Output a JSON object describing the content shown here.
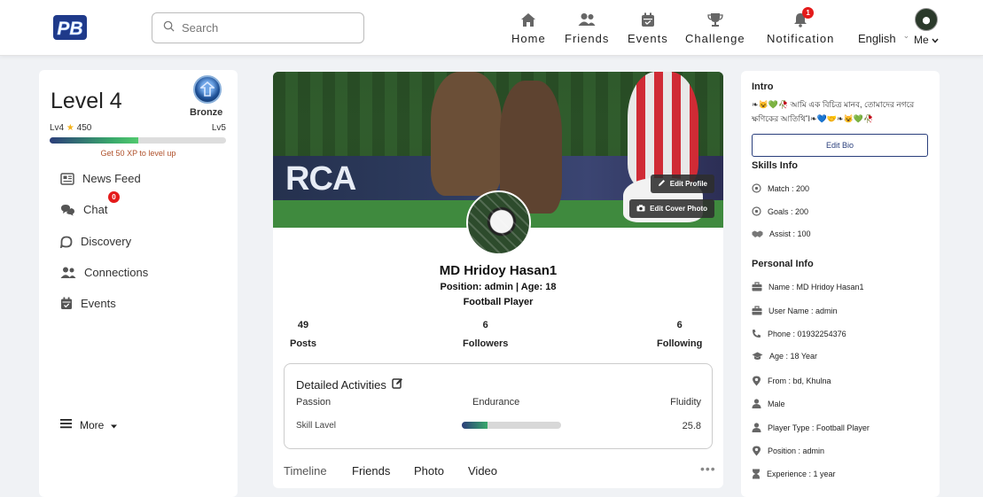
{
  "header": {
    "logo_text": "PB",
    "search_placeholder": "Search",
    "nav": [
      {
        "label": "Home",
        "icon": "home-icon"
      },
      {
        "label": "Friends",
        "icon": "friends-icon"
      },
      {
        "label": "Events",
        "icon": "calendar-icon"
      },
      {
        "label": "Challenge",
        "icon": "trophy-icon"
      },
      {
        "label": "Notification",
        "icon": "bell-icon",
        "badge": "1"
      }
    ],
    "language": "English",
    "me_label": "Me"
  },
  "left": {
    "level_title": "Level 4",
    "rank": "Bronze",
    "current_level": "Lv4",
    "xp": "450",
    "next_level": "Lv5",
    "xp_progress": 0.5,
    "xp_note": "Get 50 XP to level up",
    "menu": [
      {
        "label": "News Feed",
        "icon": "newspaper-icon"
      },
      {
        "label": "Chat",
        "icon": "chat-icon",
        "badge": "0"
      },
      {
        "label": "Discovery",
        "icon": "discovery-icon"
      },
      {
        "label": "Connections",
        "icon": "connections-icon"
      },
      {
        "label": "Events",
        "icon": "calendar-check-icon"
      }
    ],
    "more_label": "More"
  },
  "profile": {
    "cover_text": "RCA",
    "edit_profile_label": "Edit Profile",
    "edit_cover_label": "Edit Cover Photo",
    "name": "MD Hridoy Hasan1",
    "position_line": "Position: admin | Age: 18",
    "role_line": "Football Player",
    "stats": [
      {
        "value": "49",
        "label": "Posts"
      },
      {
        "value": "6",
        "label": "Followers"
      },
      {
        "value": "6",
        "label": "Following"
      }
    ],
    "activities": {
      "title": "Detailed Activities",
      "headers": [
        "Passion",
        "Endurance",
        "Fluidity"
      ],
      "skill_label": "Skill Lavel",
      "skill_value": "25.8",
      "skill_fraction": 0.26
    },
    "tabs": [
      "Timeline",
      "Friends",
      "Photo",
      "Video"
    ],
    "more_dots": "•••"
  },
  "right": {
    "intro_heading": "Intro",
    "bio": "❧😺💚🥀 আমি এক বিচিত্র মানব, তোমাদের নগরে ক্ষণিকের আতিথিἼ❧💙🤝❧😺💚🥀",
    "edit_bio_label": "Edit Bio",
    "skills_heading": "Skills Info",
    "skills": [
      {
        "label": "Match : 200",
        "icon": "soccer-ball-icon"
      },
      {
        "label": "Goals : 200",
        "icon": "soccer-ball-icon"
      },
      {
        "label": "Assist : 100",
        "icon": "handshake-icon"
      }
    ],
    "personal_heading": "Personal Info",
    "personal": [
      {
        "label": "Name : MD Hridoy Hasan1",
        "icon": "briefcase-icon"
      },
      {
        "label": "User Name : admin",
        "icon": "briefcase-icon"
      },
      {
        "label": "Phone : 01932254376",
        "icon": "phone-icon"
      },
      {
        "label": "Age : 18 Year",
        "icon": "graduation-cap-icon"
      },
      {
        "label": "From : bd, Khulna",
        "icon": "location-pin-icon"
      },
      {
        "label": "Male",
        "icon": "user-icon"
      },
      {
        "label": "Player Type : Football Player",
        "icon": "user-icon"
      },
      {
        "label": "Position : admin",
        "icon": "location-pin-icon"
      },
      {
        "label": "Experience : 1 year",
        "icon": "hourglass-icon"
      }
    ]
  },
  "colors": {
    "accent": "#2a3f7c",
    "badge": "#e41b1b",
    "xp_green": "#39a86b"
  }
}
